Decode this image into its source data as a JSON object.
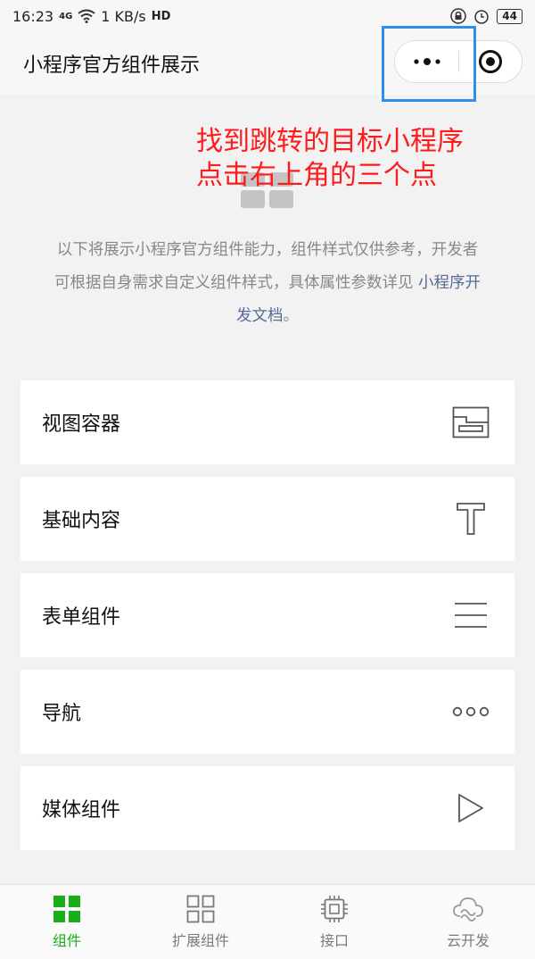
{
  "status_bar": {
    "time": "16:23",
    "network": "4G",
    "speed": "1 KB/s",
    "hd": "HD",
    "battery": "44"
  },
  "nav": {
    "title": "小程序官方组件展示"
  },
  "annotation": {
    "line1": "找到跳转的目标小程序",
    "line2": "点击右上角的三个点"
  },
  "intro": {
    "text": "以下将展示小程序官方组件能力，组件样式仅供参考，开发者可根据自身需求自定义组件样式，具体属性参数详见",
    "link": "小程序开发文档",
    "end": "。"
  },
  "list": [
    {
      "label": "视图容器",
      "icon": "view-container-icon"
    },
    {
      "label": "基础内容",
      "icon": "text-icon"
    },
    {
      "label": "表单组件",
      "icon": "form-lines-icon"
    },
    {
      "label": "导航",
      "icon": "three-dots-icon"
    },
    {
      "label": "媒体组件",
      "icon": "play-icon"
    }
  ],
  "tabs": [
    {
      "label": "组件",
      "icon": "component-grid-icon",
      "active": true
    },
    {
      "label": "扩展组件",
      "icon": "extend-grid-icon",
      "active": false
    },
    {
      "label": "接口",
      "icon": "chip-icon",
      "active": false
    },
    {
      "label": "云开发",
      "icon": "cloud-icon",
      "active": false
    }
  ],
  "colors": {
    "accent": "#1aad19",
    "annotation": "#ff1b1b",
    "highlight": "#2e8ef0",
    "link": "#576b95"
  }
}
